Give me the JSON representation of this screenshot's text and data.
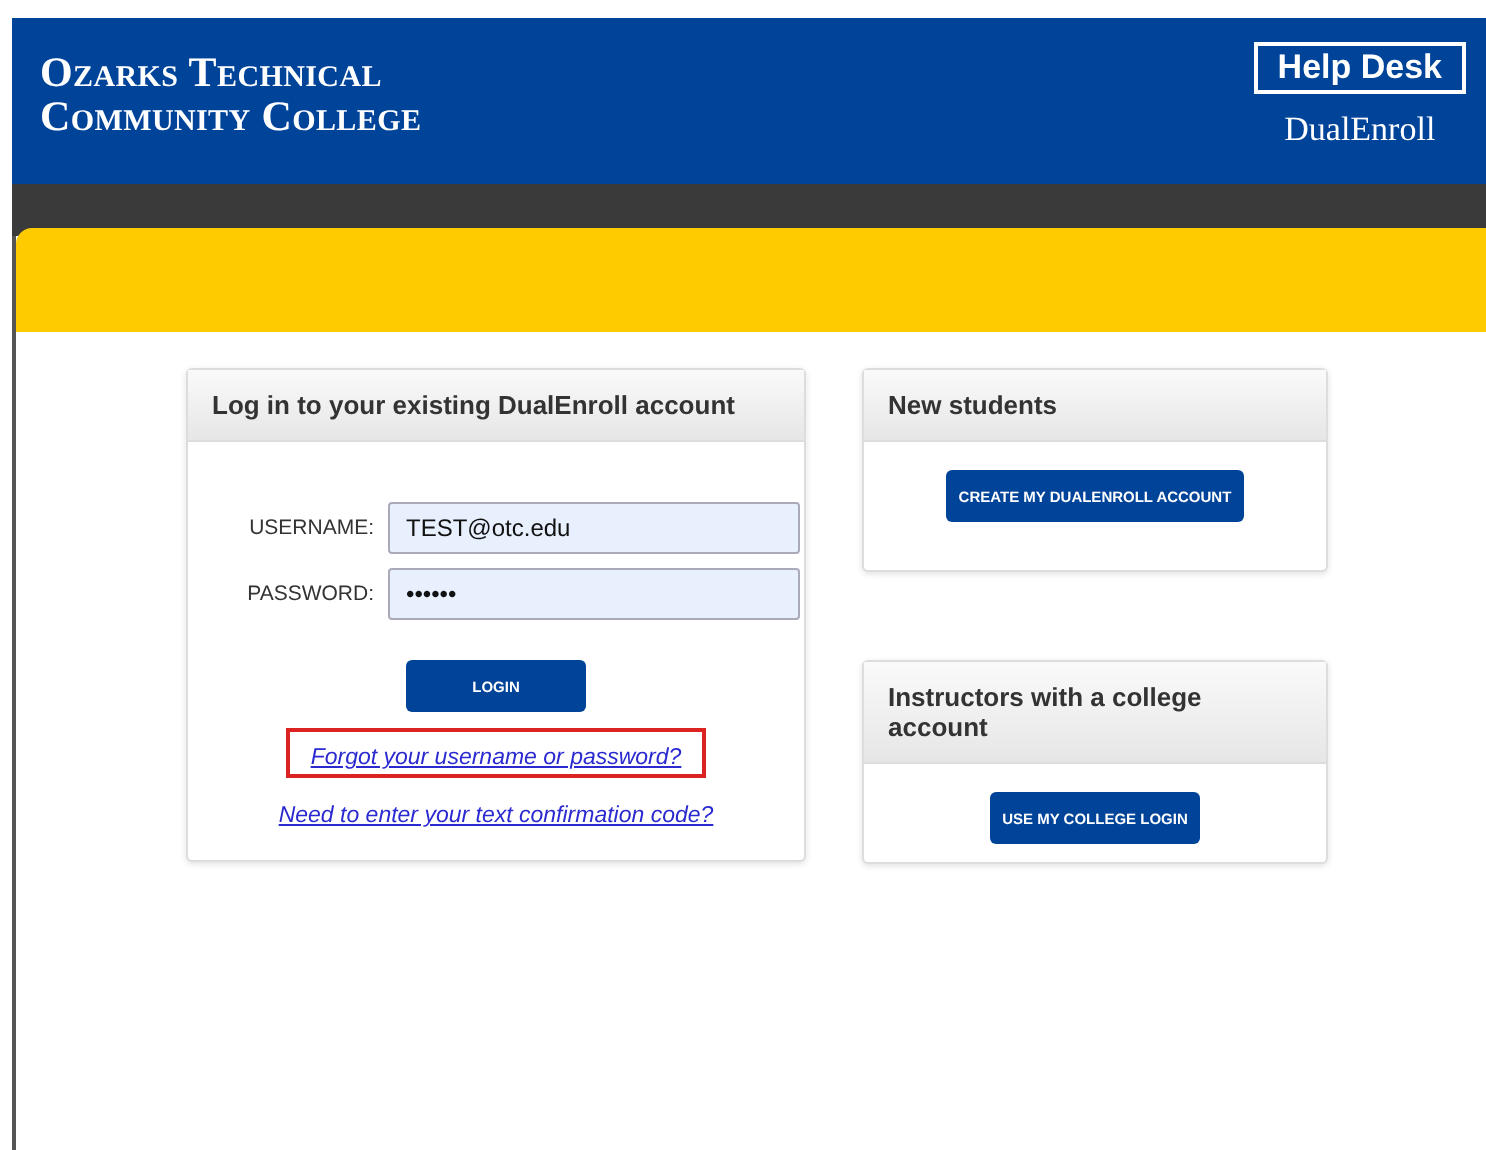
{
  "header": {
    "college_name": [
      "Ozarks Technical",
      "Community College"
    ],
    "help_desk": "Help Desk",
    "brand": "DualEnroll"
  },
  "login_card": {
    "title": "Log in to your existing DualEnroll account",
    "fields": [
      {
        "label": "USERNAME:",
        "value": "TEST@otc.edu"
      },
      {
        "label": "PASSWORD:",
        "value": "••••••"
      }
    ],
    "button": "LOGIN",
    "links": [
      {
        "text": "Forgot your username or password?",
        "highlighted": true
      },
      {
        "text": "Need to enter your text confirmation code?",
        "highlighted": false
      }
    ]
  },
  "side_cards": [
    {
      "title": "New students",
      "button": "CREATE MY DUALENROLL ACCOUNT"
    },
    {
      "title": "Instructors with a college account",
      "button": "USE MY COLLEGE LOGIN"
    }
  ]
}
